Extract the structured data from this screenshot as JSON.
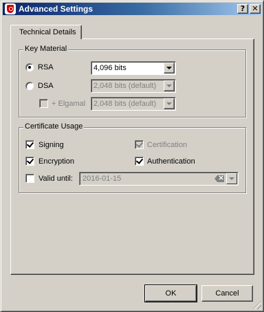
{
  "window": {
    "title": "Advanced Settings",
    "help_label": "?",
    "close_label": "X"
  },
  "tabs": [
    {
      "label": "Technical Details",
      "selected": true
    }
  ],
  "key_material": {
    "title": "Key Material",
    "rsa": {
      "label": "RSA",
      "selected": true,
      "size": "4,096 bits",
      "enabled": true
    },
    "dsa": {
      "label": "DSA",
      "selected": false,
      "size": "2,048 bits (default)",
      "enabled": false
    },
    "elgamal": {
      "label": "+ Elgamal",
      "checked": false,
      "size": "2,048 bits (default)",
      "enabled": false
    }
  },
  "certificate_usage": {
    "title": "Certificate Usage",
    "signing": {
      "label": "Signing",
      "checked": true
    },
    "certification": {
      "label": "Certification",
      "checked": true,
      "enabled": false
    },
    "encryption": {
      "label": "Encryption",
      "checked": true
    },
    "authentication": {
      "label": "Authentication",
      "checked": true
    },
    "valid_until": {
      "label": "Valid until:",
      "checked": false,
      "value": "2016-01-15"
    }
  },
  "buttons": {
    "ok": "OK",
    "cancel": "Cancel"
  },
  "colors": {
    "title_gradient_start": "#0a246a",
    "title_gradient_end": "#a6caf0",
    "face": "#d4d0c8",
    "disabled_text": "#808080"
  }
}
